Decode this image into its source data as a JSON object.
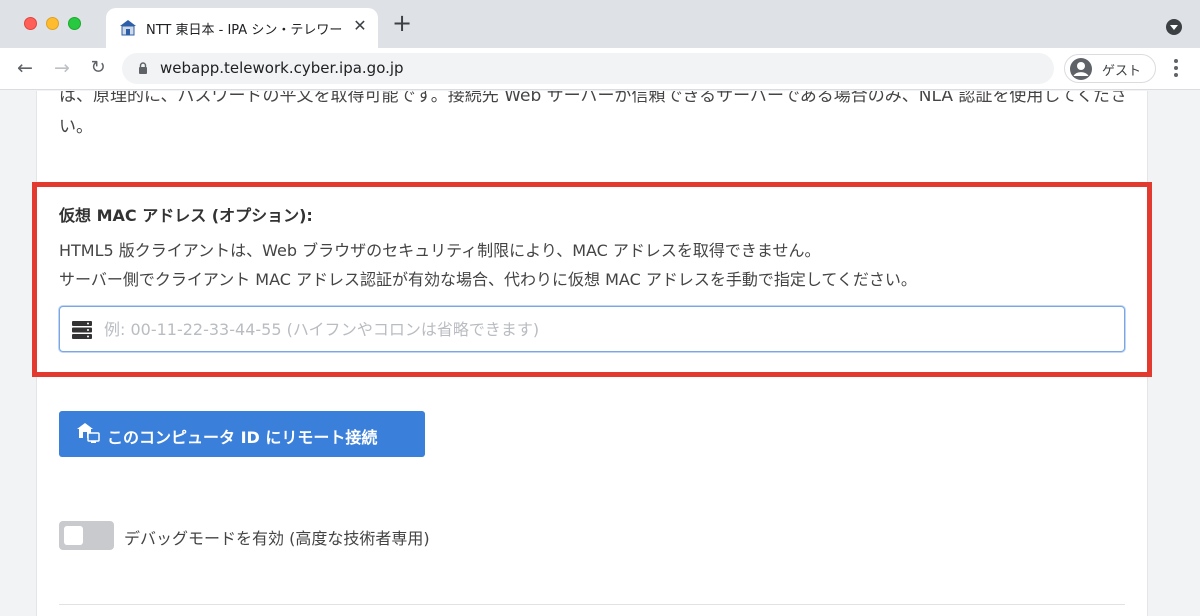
{
  "browser": {
    "tab": {
      "title": "NTT 東日本 - IPA シン・テレワー",
      "close_glyph": "✕"
    },
    "new_tab_glyph": "+",
    "nav": {
      "back_glyph": "←",
      "forward_glyph": "→",
      "reload_glyph": "↻"
    },
    "url": "webapp.telework.cyber.ipa.go.jp",
    "profile_label": "ゲスト"
  },
  "page": {
    "intro_text": "は、原理的に、パスワードの平文を取得可能です。接続先 Web サーバーが信頼できるサーバーである場合のみ、NLA 認証を使用してください。",
    "mac_section": {
      "label": "仮想 MAC アドレス (オプション):",
      "description_1": "HTML5 版クライアントは、Web ブラウザのセキュリティ制限により、MAC アドレスを取得できません。",
      "description_2": "サーバー側でクライアント MAC アドレス認証が有効な場合、代わりに仮想 MAC アドレスを手動で指定してください。",
      "input_value": "",
      "input_placeholder": "例: 00-11-22-33-44-55 (ハイフンやコロンは省略できます)"
    },
    "connect_button_label": "このコンピュータ ID にリモート接続",
    "debug_toggle": {
      "label": "デバッグモードを有効 (高度な技術者専用)",
      "enabled": false
    }
  },
  "colors": {
    "highlight_border": "#e23a2e",
    "primary_button": "#3a7fd9",
    "input_focus_border": "#7aa7e3",
    "toggle_off": "#c8cacd"
  },
  "icons": {
    "tab_favicon": "house-favicon-icon",
    "lock": "lock-icon",
    "profile": "account-circle-icon",
    "menu": "vertical-dots-icon",
    "mac_field": "server-icon",
    "connect": "remote-house-icon"
  }
}
